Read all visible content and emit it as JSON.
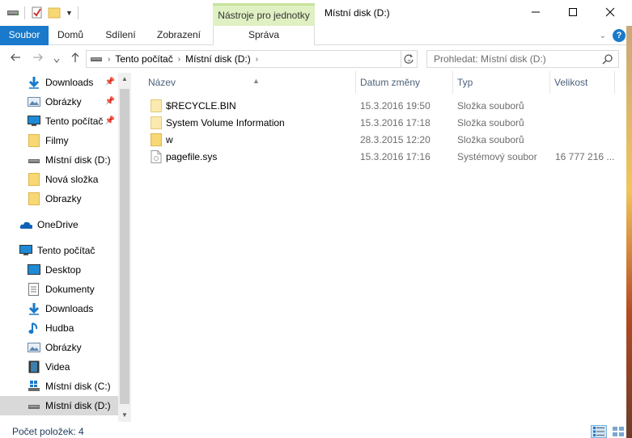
{
  "window": {
    "title": "Místní disk (D:)",
    "minimize": "—",
    "maximize": "☐",
    "close": "✕"
  },
  "ribbon": {
    "context_group": "Nástroje pro jednotky",
    "tabs": [
      "Soubor",
      "Domů",
      "Sdílení",
      "Zobrazení"
    ],
    "context_tab": "Správa"
  },
  "address": {
    "crumbs": [
      "Tento počítač",
      "Místní disk (D:)"
    ],
    "search_placeholder": "Prohledat: Místní disk (D:)"
  },
  "sidebar": {
    "quick_access": [
      {
        "label": "Downloads",
        "icon": "download-icon",
        "pinned": true
      },
      {
        "label": "Obrázky",
        "icon": "pictures-icon",
        "pinned": true
      },
      {
        "label": "Tento počítač",
        "icon": "computer-icon",
        "pinned": true
      },
      {
        "label": "Filmy",
        "icon": "folder-icon",
        "pinned": false
      },
      {
        "label": "Místní disk (D:)",
        "icon": "drive-icon",
        "pinned": false
      },
      {
        "label": "Nová složka",
        "icon": "folder-icon",
        "pinned": false
      },
      {
        "label": "Obrazky",
        "icon": "folder-icon",
        "pinned": false
      }
    ],
    "onedrive": "OneDrive",
    "this_pc": "Tento počítač",
    "this_pc_items": [
      {
        "label": "Desktop",
        "icon": "desktop-icon"
      },
      {
        "label": "Dokumenty",
        "icon": "documents-icon"
      },
      {
        "label": "Downloads",
        "icon": "download-icon"
      },
      {
        "label": "Hudba",
        "icon": "music-icon"
      },
      {
        "label": "Obrázky",
        "icon": "pictures-icon"
      },
      {
        "label": "Videa",
        "icon": "video-icon"
      },
      {
        "label": "Místní disk (C:)",
        "icon": "windows-drive-icon"
      },
      {
        "label": "Místní disk (D:)",
        "icon": "drive-icon",
        "selected": true
      }
    ]
  },
  "columns": {
    "name": "Název",
    "date": "Datum změny",
    "type": "Typ",
    "size": "Velikost"
  },
  "files": [
    {
      "name": "$RECYCLE.BIN",
      "date": "15.3.2016 19:50",
      "type": "Složka souborů",
      "size": "",
      "icon": "folder-icon"
    },
    {
      "name": "System Volume Information",
      "date": "15.3.2016 17:18",
      "type": "Složka souborů",
      "size": "",
      "icon": "folder-icon"
    },
    {
      "name": "w",
      "date": "28.3.2015 12:20",
      "type": "Složka souborů",
      "size": "",
      "icon": "folder-icon"
    },
    {
      "name": "pagefile.sys",
      "date": "15.3.2016 17:16",
      "type": "Systémový soubor",
      "size": "16 777 216 ...",
      "icon": "file-icon"
    }
  ],
  "status": {
    "count": "Počet položek: 4"
  },
  "colors": {
    "accent": "#1979ca",
    "context_tab": "#dff0c2",
    "folder": "#f8d775"
  }
}
